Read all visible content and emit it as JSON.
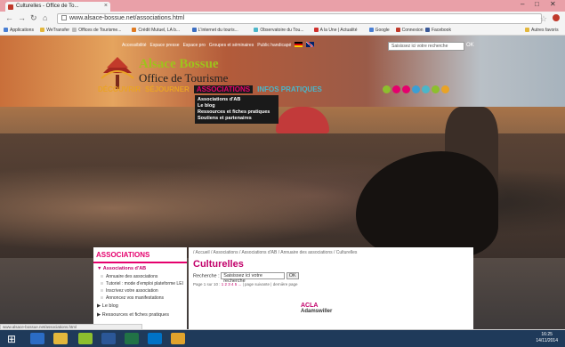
{
  "browser": {
    "tab_title": "Culturelles - Office de To...",
    "url": "www.alsace-bossue.net/associations.html",
    "bookmarks": [
      {
        "label": "Applications",
        "color": "#4a7fd3"
      },
      {
        "label": "WeTransfer",
        "color": "#e3b73c"
      },
      {
        "label": "Offices de Tourisme...",
        "color": "#bbbbbb"
      },
      {
        "label": "Crédit Mutuel, LA b...",
        "color": "#e07b22"
      },
      {
        "label": "L'internet du touris...",
        "color": "#3b6ec2"
      },
      {
        "label": "Observatoire du Tou...",
        "color": "#4bb6c9"
      },
      {
        "label": "A la Une | Actualité",
        "color": "#d0312d"
      },
      {
        "label": "Google",
        "color": "#4a7fd3"
      },
      {
        "label": "Connexion",
        "color": "#c0392b"
      },
      {
        "label": "Facebook",
        "color": "#3b5998"
      },
      {
        "label": "Autres favoris",
        "color": "#e3b73c"
      }
    ]
  },
  "site": {
    "topnav": [
      "Accessibilité",
      "Espace presse",
      "Espace pro",
      "Groupes et séminaires",
      "Public handicapé"
    ],
    "search_placeholder": "Saisissez ici votre recherche",
    "search_ok": "OK",
    "logo_name": "Alsace Bossue",
    "logo_sub": "Office de Tourisme",
    "mainnav": {
      "decouvrir": "DÉCOUVRIR",
      "sejourner": "SÉJOURNER",
      "associations": "ASSOCIATIONS",
      "infos": "INFOS PRATIQUES"
    },
    "dropdown": [
      "Associations d'AB",
      "Le blog",
      "Ressources et fiches pratiques",
      "Soutiens et partenaires"
    ],
    "social_colors": [
      "#8dbf2e",
      "#e5006d",
      "#e5006d",
      "#3b9fd4",
      "#4bb6c9",
      "#8dbf2e",
      "#e9a326"
    ]
  },
  "sidebar": {
    "title": "ASSOCIATIONS",
    "section": "Associations d'AB",
    "items": [
      "Annuaire des associations",
      "Tutoriel : mode d'emploi plateforme LEI",
      "Inscrivez votre association",
      "Annoncez vos manifestations"
    ],
    "links": [
      "Le blog",
      "Ressources et fiches pratiques"
    ]
  },
  "content": {
    "breadcrumb": "/ Accueil / Associations / Associations d'AB / Annuaire des associations / Culturelles",
    "title": "Culturelles",
    "search_label": "Recherche :",
    "search_value": "Saisissez ici votre recherche",
    "search_button": "OK",
    "pager_prefix": "Page 1 sur 10 :",
    "pager_pages": "1 2 3 4 5 ...",
    "pager_next": "| page suivante | dernière page",
    "result_title": "ACLA",
    "result_sub": "Adamswiller"
  },
  "status_text": "www.alsace-bossue.net/associations.html",
  "clock": {
    "time": "16:25",
    "date": "14/11/2014"
  }
}
